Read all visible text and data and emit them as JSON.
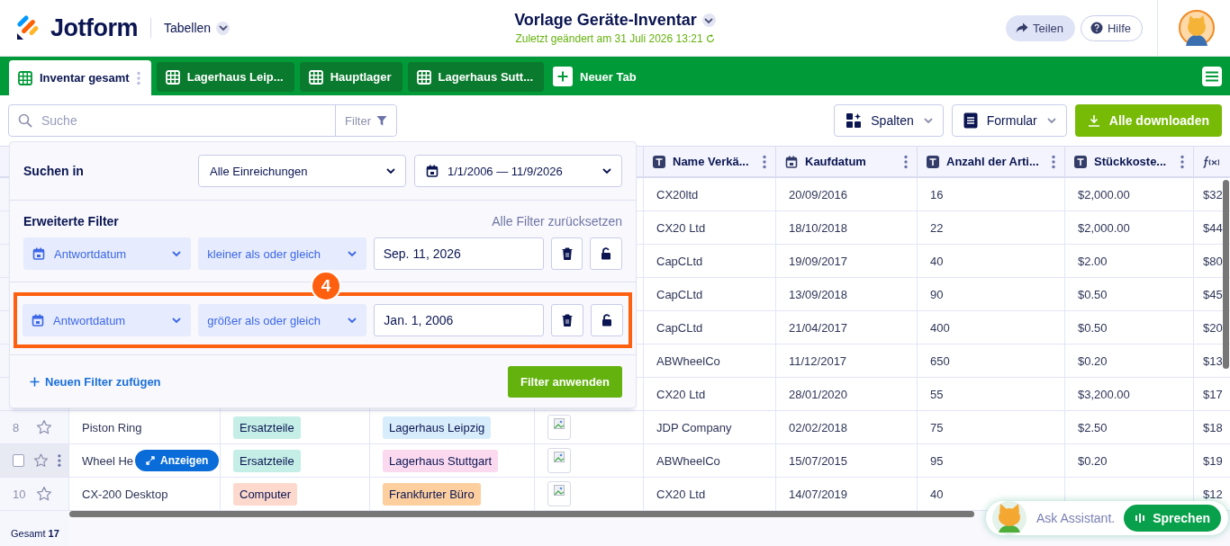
{
  "header": {
    "logo": "Jotform",
    "section": "Tabellen",
    "title": "Vorlage Geräte-Inventar",
    "subtitle": "Zuletzt geändert am 31 Juli 2026 13:21",
    "share": "Teilen",
    "help": "Hilfe"
  },
  "tabs": [
    {
      "label": "Inventar gesamt",
      "selected": true
    },
    {
      "label": "Lagerhaus Leip...",
      "selected": false
    },
    {
      "label": "Hauptlager",
      "selected": false
    },
    {
      "label": "Lagerhaus Sutt...",
      "selected": false
    }
  ],
  "new_tab": "Neuer Tab",
  "toolbar": {
    "search_placeholder": "Suche",
    "filter": "Filter",
    "columns": "Spalten",
    "form": "Formular",
    "download": "Alle downloaden"
  },
  "table": {
    "columns": [
      {
        "label": "Name Verkä...",
        "kind": "text"
      },
      {
        "label": "Kaufdatum",
        "kind": "date"
      },
      {
        "label": "Anzahl der Arti...",
        "kind": "text"
      },
      {
        "label": "Stückkoste...",
        "kind": "text"
      },
      {
        "kind": "formula"
      }
    ],
    "rows": [
      {
        "vendor": "CX20ltd",
        "date": "20/09/2016",
        "count": "16",
        "cost": "$2,000.00",
        "column_10": "$32"
      },
      {
        "vendor": "CX20 Ltd",
        "date": "18/10/2018",
        "count": "22",
        "cost": "$2,000.00",
        "column_10": "$44"
      },
      {
        "vendor": "CapCLtd",
        "date": "19/09/2017",
        "count": "40",
        "cost": "$2.00",
        "column_10": "$80"
      },
      {
        "vendor": "CapCLtd",
        "date": "13/09/2018",
        "count": "90",
        "cost": "$0.50",
        "column_10": "$45"
      },
      {
        "vendor": "CapCLtd",
        "date": "21/04/2017",
        "count": "400",
        "cost": "$0.50",
        "column_10": "$20"
      },
      {
        "vendor": "ABWheelCo",
        "date": "11/12/2017",
        "count": "650",
        "cost": "$0.20",
        "column_10": "$13"
      },
      {
        "vendor": "CX20 Ltd",
        "date": "28/01/2020",
        "count": "55",
        "cost": "$3,200.00",
        "column_10": "$17"
      },
      {
        "number": "8",
        "hovered": false,
        "starred": false,
        "name": "Piston Ring",
        "category": {
          "label": "Ersatzteile",
          "color": "#c4eee6"
        },
        "location": {
          "label": "Lagerhaus Leipzig",
          "color": "#d8edfb"
        },
        "image": {
          "kind": "broken"
        },
        "vendor": "JDP Company",
        "date": "02/02/2018",
        "count": "75",
        "cost": "$2.50",
        "column_10": "$18"
      },
      {
        "hovered": true,
        "checked": false,
        "starred": false,
        "name": "Wheel He",
        "action": "Anzeigen",
        "category": {
          "label": "Ersatzteile",
          "color": "#c4eee6"
        },
        "location": {
          "label": "Lagerhaus Stuttgart",
          "color": "#fbdaf0"
        },
        "image": {
          "kind": "broken"
        },
        "vendor": "ABWheelCo",
        "date": "15/07/2015",
        "count": "95",
        "cost": "$0.20",
        "column_10": "$19"
      },
      {
        "number": "10",
        "hovered": false,
        "starred": false,
        "name": "CX-200 Desktop",
        "category": {
          "label": "Computer",
          "color": "#fdd9cd"
        },
        "location": {
          "label": "Frankfurter Büro",
          "color": "#fdcf9f"
        },
        "image": {
          "kind": "broken"
        },
        "vendor": "CX20 Ltd",
        "date": "14/07/2019",
        "count": "40",
        "column_10": "$12"
      }
    ],
    "footer": "Gesamt **17**"
  },
  "filter_panel": {
    "search_in_label": "Suchen in",
    "scope": "Alle Einreichungen",
    "date_range": "1/1/2006 — 11/9/2026",
    "advanced_label": "Erweiterte Filter",
    "reset": "Alle Filter zurücksetzen",
    "filters": [
      {
        "field": "Antwortdatum",
        "operator": "kleiner als oder gleich",
        "value": "Sep. 11, 2026",
        "highlighted": false
      },
      {
        "field": "Antwortdatum",
        "operator": "größer als oder gleich",
        "value": "Jan. 1, 2006",
        "highlighted": true,
        "badge": "4"
      }
    ],
    "add": "Neuen Filter zufügen",
    "apply": "Filter anwenden"
  },
  "assistant": {
    "placeholder": "Ask Assistant.",
    "talk": "Sprechen"
  }
}
